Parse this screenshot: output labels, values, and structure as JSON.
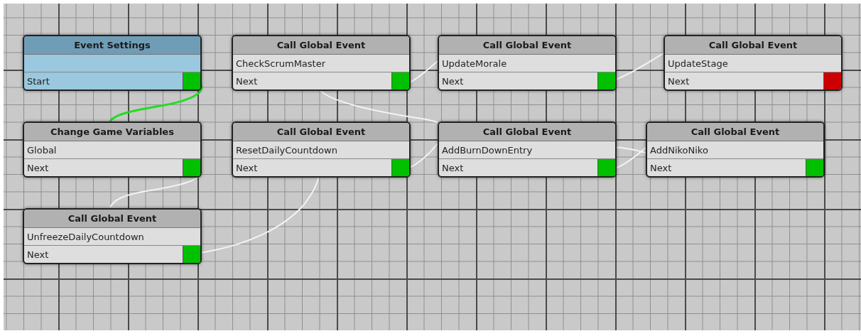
{
  "nodes": [
    {
      "kind": "settings",
      "title": "Event Settings",
      "port": {
        "label": "Start",
        "color": "#00c000"
      }
    },
    {
      "kind": "action",
      "title": "Call Global Event",
      "field": "CheckScrumMaster",
      "port": {
        "label": "Next",
        "color": "#00c000"
      }
    },
    {
      "kind": "action",
      "title": "Call Global Event",
      "field": "UpdateMorale",
      "port": {
        "label": "Next",
        "color": "#00c000"
      }
    },
    {
      "kind": "action",
      "title": "Call Global Event",
      "field": "UpdateStage",
      "port": {
        "label": "Next",
        "color": "#cc0000"
      }
    },
    {
      "kind": "action",
      "title": "Change Game Variables",
      "field": "Global",
      "port": {
        "label": "Next",
        "color": "#00c000"
      }
    },
    {
      "kind": "action",
      "title": "Call Global Event",
      "field": "ResetDailyCountdown",
      "port": {
        "label": "Next",
        "color": "#00c000"
      }
    },
    {
      "kind": "action",
      "title": "Call Global Event",
      "field": "AddBurnDownEntry",
      "port": {
        "label": "Next",
        "color": "#00c000"
      }
    },
    {
      "kind": "action",
      "title": "Call Global Event",
      "field": "AddNikoNiko",
      "port": {
        "label": "Next",
        "color": "#00c000"
      }
    },
    {
      "kind": "action",
      "title": "Call Global Event",
      "field": "UnfreezeDailyCountdown",
      "port": {
        "label": "Next",
        "color": "#00c000"
      }
    }
  ]
}
